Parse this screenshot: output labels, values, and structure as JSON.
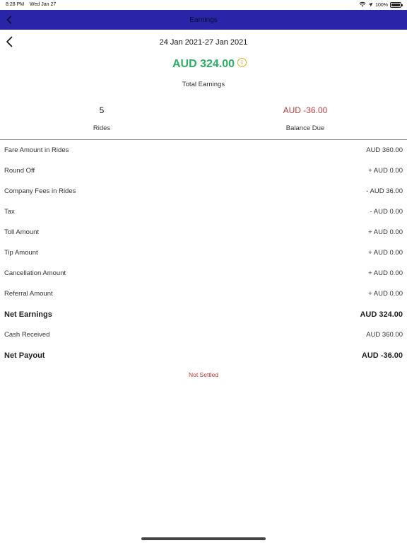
{
  "status_bar": {
    "time": "8:28 PM",
    "date": "Wed Jan 27",
    "battery": "100%"
  },
  "nav": {
    "title": "Earnings"
  },
  "header": {
    "date_range": "24 Jan 2021-27 Jan 2021"
  },
  "total": {
    "amount": "AUD 324.00",
    "label": "Total Earnings",
    "info_glyph": "i"
  },
  "stats": {
    "rides_value": "5",
    "rides_label": "Rides",
    "balance_value": "AUD -36.00",
    "balance_label": "Balance Due"
  },
  "rows": [
    {
      "label": "Fare Amount in Rides",
      "value": "AUD 360.00",
      "bold": false
    },
    {
      "label": "Round Off",
      "value": "+ AUD 0.00",
      "bold": false
    },
    {
      "label": "Company Fees in Rides",
      "value": "- AUD 36.00",
      "bold": false
    },
    {
      "label": "Tax",
      "value": "- AUD 0.00",
      "bold": false
    },
    {
      "label": "Toll Amount",
      "value": "+ AUD 0.00",
      "bold": false
    },
    {
      "label": "Tip Amount",
      "value": "+ AUD 0.00",
      "bold": false
    },
    {
      "label": "Cancellation Amount",
      "value": "+ AUD 0.00",
      "bold": false
    },
    {
      "label": "Referral Amount",
      "value": "+ AUD 0.00",
      "bold": false
    },
    {
      "label": "Net Earnings",
      "value": "AUD 324.00",
      "bold": true
    },
    {
      "label": "Cash Received",
      "value": "AUD 360.00",
      "bold": false
    },
    {
      "label": "Net Payout",
      "value": "AUD -36.00",
      "bold": true
    }
  ],
  "settlement": {
    "status": "Not Settled"
  },
  "colors": {
    "nav_bar": "#2a25a8",
    "total_green": "#2cae63",
    "due_red": "#c0393b",
    "info_yellow": "#e2b12b"
  }
}
